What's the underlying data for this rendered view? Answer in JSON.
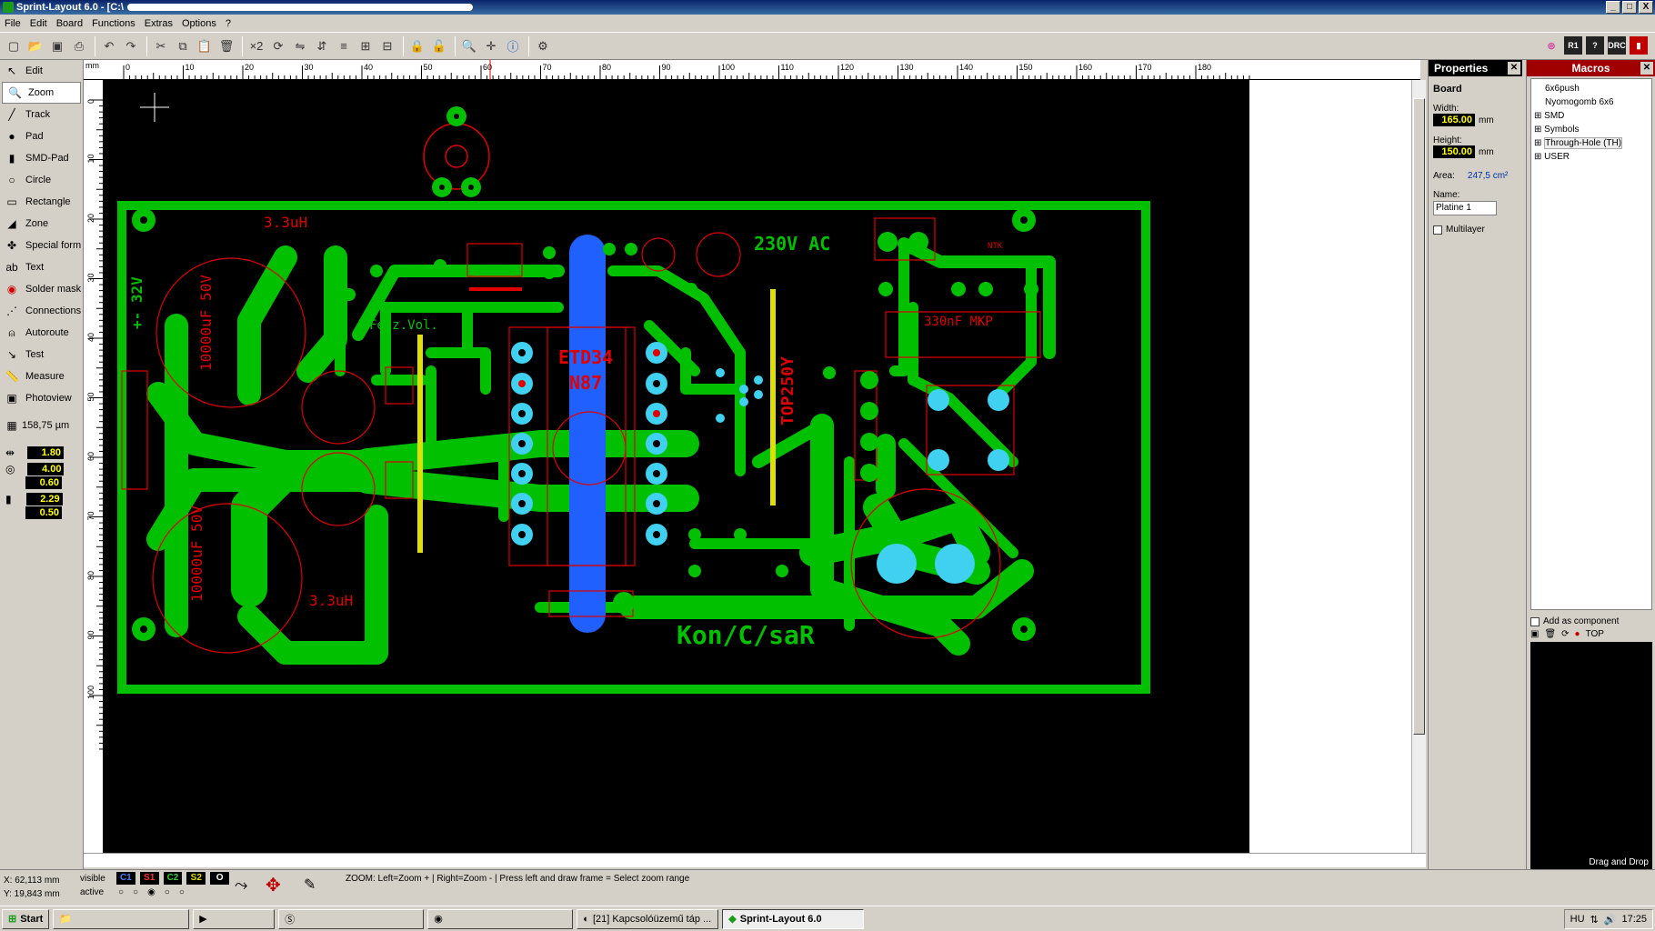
{
  "window": {
    "title": "Sprint-Layout 6.0 - [C:\\",
    "controls": [
      "_",
      "□",
      "X"
    ]
  },
  "menu": [
    "File",
    "Edit",
    "Board",
    "Functions",
    "Extras",
    "Options",
    "?"
  ],
  "tools": [
    {
      "label": "Edit",
      "icon": "cursor-icon"
    },
    {
      "label": "Zoom",
      "icon": "zoom-icon"
    },
    {
      "label": "Track",
      "icon": "track-icon"
    },
    {
      "label": "Pad",
      "icon": "pad-icon"
    },
    {
      "label": "SMD-Pad",
      "icon": "smd-pad-icon"
    },
    {
      "label": "Circle",
      "icon": "circle-icon"
    },
    {
      "label": "Rectangle",
      "icon": "rectangle-icon"
    },
    {
      "label": "Zone",
      "icon": "zone-icon"
    },
    {
      "label": "Special form",
      "icon": "special-form-icon"
    },
    {
      "label": "Text",
      "icon": "text-icon"
    },
    {
      "label": "Solder mask",
      "icon": "solder-mask-icon"
    },
    {
      "label": "Connections",
      "icon": "connections-icon"
    },
    {
      "label": "Autoroute",
      "icon": "autoroute-icon"
    },
    {
      "label": "Test",
      "icon": "test-icon"
    },
    {
      "label": "Measure",
      "icon": "measure-icon"
    },
    {
      "label": "Photoview",
      "icon": "photoview-icon"
    }
  ],
  "grid": "158,75 µm",
  "track_width": "1.80",
  "pad_outer": "4.00",
  "pad_inner": "0.60",
  "smd_w": "2.29",
  "smd_h": "0.50",
  "ruler_h": [
    "0",
    "10",
    "20",
    "30",
    "40",
    "50",
    "60",
    "70",
    "80",
    "90",
    "100",
    "110",
    "120",
    "130",
    "140",
    "150",
    "160",
    "170",
    "180"
  ],
  "ruler_v": [
    "0",
    "10",
    "20",
    "30",
    "40",
    "50",
    "60",
    "70",
    "80",
    "90",
    "100"
  ],
  "ruler_unit": "mm",
  "properties": {
    "title": "Properties",
    "section": "Board",
    "width_label": "Width:",
    "width": "165.00",
    "height_label": "Height:",
    "height": "150.00",
    "unit": "mm",
    "area_label": "Area:",
    "area": "247,5 cm²",
    "name_label": "Name:",
    "name": "Platine 1",
    "multilayer": "Multilayer"
  },
  "macros": {
    "title": "Macros",
    "items": [
      "6x6push",
      "Nyomogomb 6x6",
      "SMD",
      "Symbols",
      "Through-Hole (TH)",
      "USER"
    ],
    "add_component": "Add as component",
    "top": "TOP",
    "drag_drop": "Drag and Drop"
  },
  "pcb_text": {
    "l1": "3.3uH",
    "l2": "3.3uH",
    "cap1": "10000uF 50V",
    "cap2": "10000uF 50V",
    "v32": "+- 32V",
    "ac": "230V AC",
    "etd": "ETD34",
    "n87": "N87",
    "top": "TOP250Y",
    "mkp": "330nF MKP",
    "kon": "Kon/C/saR",
    "fesz": "Fesz.Vol.",
    "ntk": "NTK"
  },
  "status": {
    "x": "X:  62,113 mm",
    "y": "Y:  19,843 mm",
    "visible": "visible",
    "active": "active",
    "layers": [
      "C1",
      "S1",
      "C2",
      "S2",
      "O"
    ],
    "message": "ZOOM:  Left=Zoom +  |  Right=Zoom -  |  Press left and draw frame = Select zoom range"
  },
  "taskbar": {
    "start": "Start",
    "tasks": [
      "[21] Kapcsolóüzemű táp ...",
      "Sprint-Layout 6.0"
    ],
    "lang": "HU",
    "time": "17:25"
  },
  "colors": {
    "copper_top": "#00c000",
    "silk": "#e00000",
    "bridge": "#2060ff",
    "pad_light": "#40d0f0",
    "bar": "#e0e000"
  }
}
